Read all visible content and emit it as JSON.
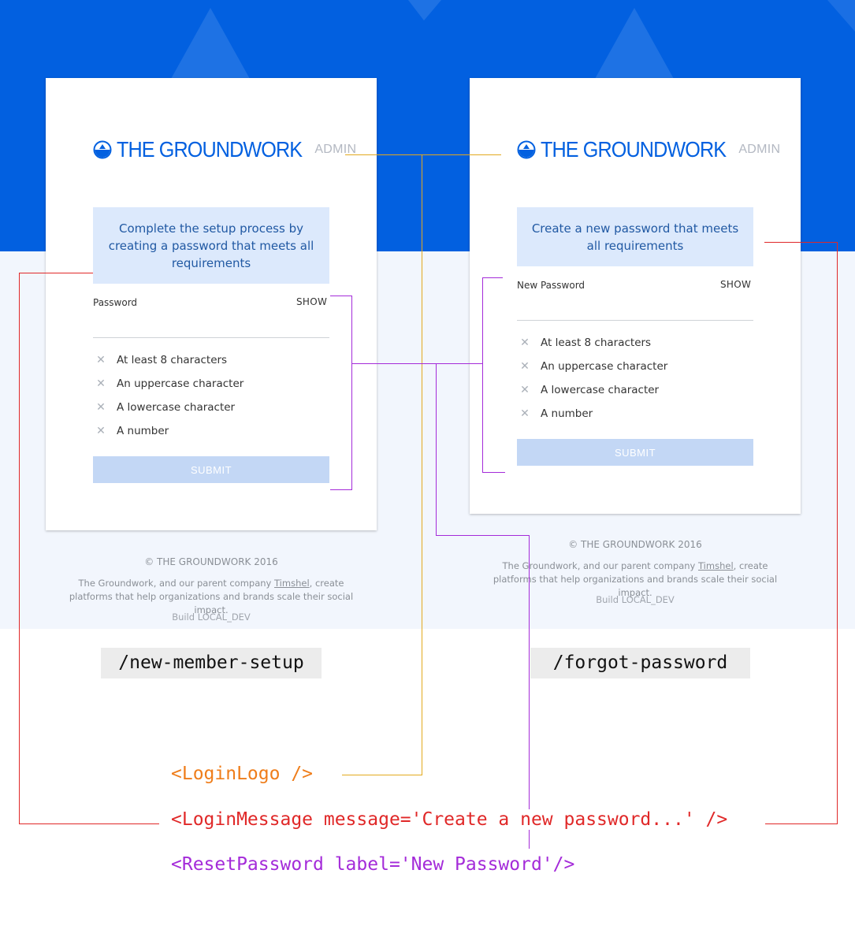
{
  "colors": {
    "brand": "#0260e0",
    "annotation_yellow": "#e3a91e",
    "annotation_red": "#e02828",
    "annotation_purple": "#a42bd9"
  },
  "cards": [
    {
      "logo": {
        "icon": "groundwork-logo-icon",
        "word": "THE GROUNDWORK",
        "admin": "ADMIN"
      },
      "message": "Complete the setup process by creating a password that meets all requirements",
      "field_label": "Password",
      "show_label": "SHOW",
      "requirements": [
        "At least 8 characters",
        "An uppercase character",
        "A lowercase character",
        "A number"
      ],
      "submit_label": "SUBMIT",
      "footer": {
        "copyright": "© THE GROUNDWORK 2016",
        "desc_pre": "The Groundwork, and our parent company ",
        "desc_link": "Timshel",
        "desc_post": ", create platforms that help organizations and brands scale their social impact.",
        "build": "Build LOCAL_DEV"
      },
      "route": "/new-member-setup"
    },
    {
      "logo": {
        "icon": "groundwork-logo-icon",
        "word": "THE GROUNDWORK",
        "admin": "ADMIN"
      },
      "message": "Create a new password that meets all requirements",
      "field_label": "New Password",
      "show_label": "SHOW",
      "requirements": [
        "At least 8 characters",
        "An uppercase character",
        "A lowercase character",
        "A number"
      ],
      "submit_label": "SUBMIT",
      "footer": {
        "copyright": "© THE GROUNDWORK 2016",
        "desc_pre": "The Groundwork, and our parent company ",
        "desc_link": "Timshel",
        "desc_post": ", create platforms that help organizations and brands scale their social impact.",
        "build": "Build LOCAL_DEV"
      },
      "route": "/forgot-password"
    }
  ],
  "code": {
    "login_logo": "<LoginLogo />",
    "login_message": "<LoginMessage message='Create a new password...' />",
    "reset_password": "<ResetPassword label='New Password'/>"
  }
}
